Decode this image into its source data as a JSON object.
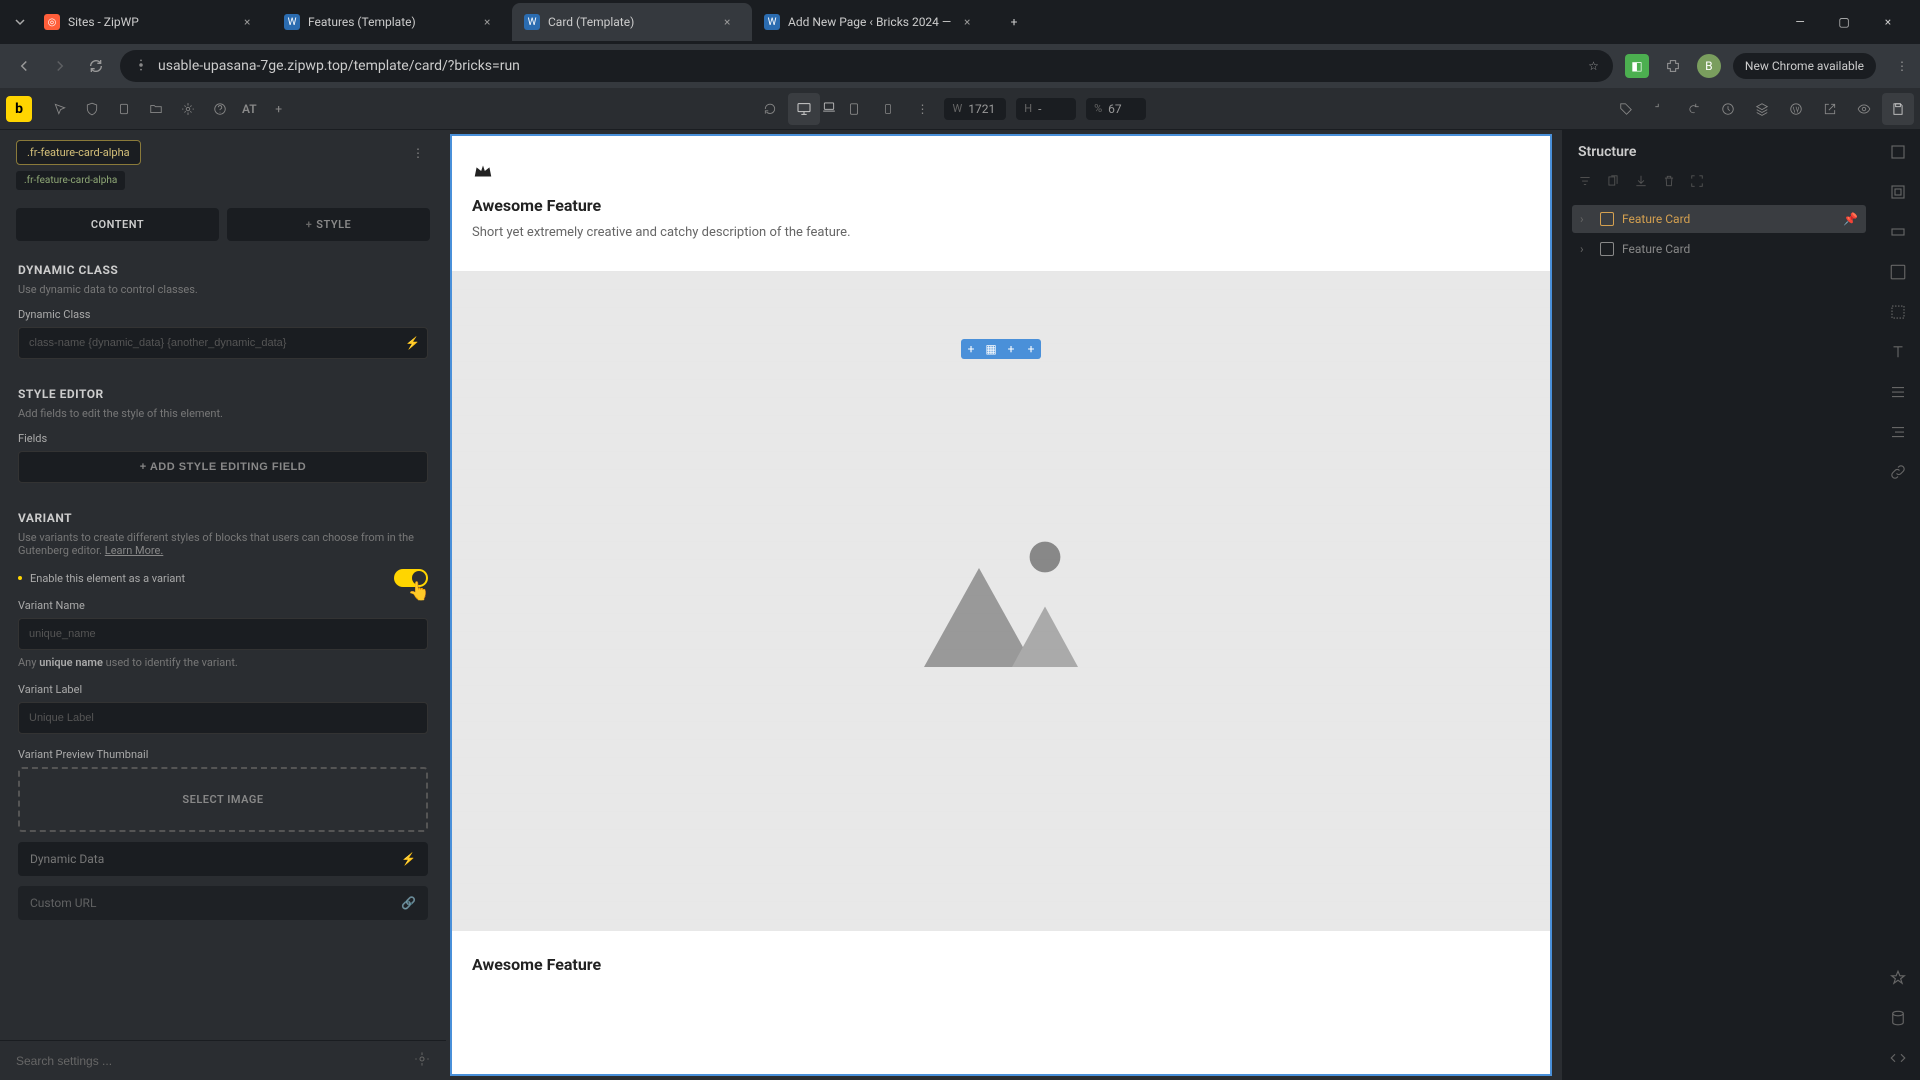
{
  "browser": {
    "tabs": [
      {
        "title": "Sites - ZipWP",
        "favicon_bg": "#ff5e3a",
        "favicon_text": ""
      },
      {
        "title": "Features (Template)",
        "favicon_bg": "#2b6cb0",
        "favicon_text": "W"
      },
      {
        "title": "Card (Template)",
        "favicon_bg": "#2b6cb0",
        "favicon_text": "W",
        "active": true
      },
      {
        "title": "Add New Page ‹ Bricks 2024 —",
        "favicon_bg": "#2b6cb0",
        "favicon_text": "W"
      }
    ],
    "url": "usable-upasana-7ge.zipwp.top/template/card/?bricks=run",
    "update_label": "New Chrome available",
    "avatar_letter": "B"
  },
  "toolbar": {
    "logo_letter": "b",
    "at_label": "AT",
    "width_label": "W",
    "width_value": "1721",
    "height_label": "H",
    "height_value": "-",
    "percent_label": "%",
    "percent_value": "67"
  },
  "left_panel": {
    "class_name": ".fr-feature-card-alpha",
    "sub_class": ".fr-feature-card-alpha",
    "tabs": {
      "content": "CONTENT",
      "style_prefix": "+",
      "style": "STYLE"
    },
    "dynamic_class": {
      "title": "DYNAMIC CLASS",
      "desc": "Use dynamic data to control classes.",
      "field_label": "Dynamic Class",
      "placeholder": "class-name {dynamic_data} {another_dynamic_data}"
    },
    "style_editor": {
      "title": "STYLE EDITOR",
      "desc": "Add fields to edit the style of this element.",
      "field_label": "Fields",
      "add_btn": "+ ADD STYLE EDITING FIELD"
    },
    "variant": {
      "title": "VARIANT",
      "desc_pre": "Use variants to create different styles of blocks that users can choose from in the Gutenberg editor. ",
      "learn_more": "Learn More.",
      "enable_label": "Enable this element as a variant",
      "name_label": "Variant Name",
      "name_placeholder": "unique_name",
      "name_hint_pre": "Any ",
      "name_hint_bold": "unique name",
      "name_hint_post": " used to identify the variant.",
      "label_label": "Variant Label",
      "label_placeholder": "Unique Label",
      "thumbnail_label": "Variant Preview Thumbnail",
      "select_image": "SELECT IMAGE",
      "dynamic_data": "Dynamic Data",
      "custom_url": "Custom URL"
    },
    "search_placeholder": "Search settings ..."
  },
  "canvas": {
    "card1": {
      "title": "Awesome Feature",
      "desc": "Short yet extremely creative and catchy description of the feature."
    },
    "card2": {
      "title": "Awesome Feature"
    }
  },
  "right_panel": {
    "title": "Structure",
    "items": [
      {
        "label": "Feature Card",
        "selected": true
      },
      {
        "label": "Feature Card",
        "selected": false
      }
    ]
  }
}
